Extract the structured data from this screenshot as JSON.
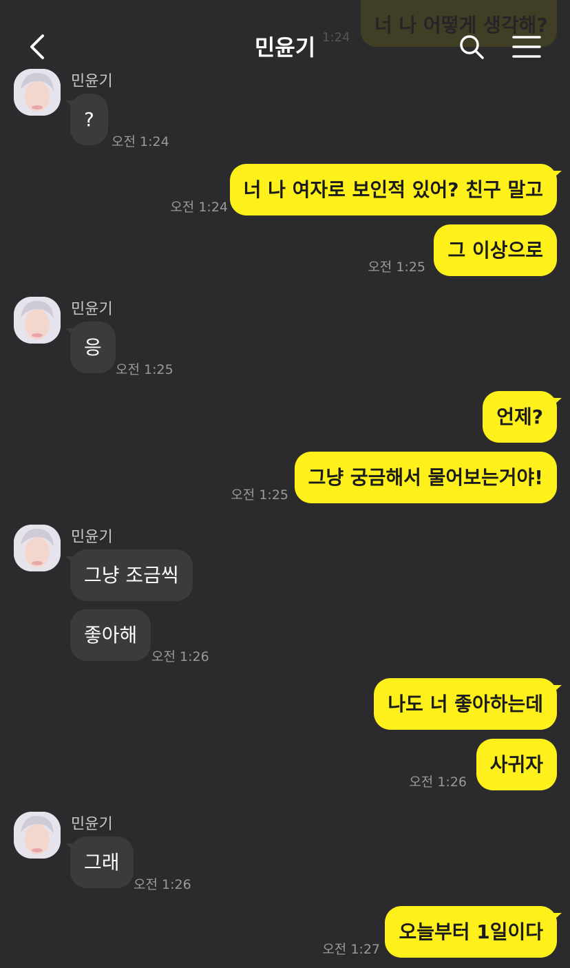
{
  "header": {
    "title": "민윤기",
    "back_icon": "chevron-left-icon",
    "search_icon": "search-icon",
    "menu_icon": "hamburger-menu-icon"
  },
  "peek": {
    "text": "너 나 어떻게 생각해?",
    "time": "1:24"
  },
  "messages": [
    {
      "sender": "민윤기",
      "text": "?",
      "time": "오전 1:24"
    },
    {
      "text": "너 나 여자로 보인적 있어? 친구 말고",
      "time": "오전 1:24"
    },
    {
      "text": "그 이상으로",
      "time": "오전 1:25"
    },
    {
      "sender": "민윤기",
      "text": "응",
      "time": "오전 1:25"
    },
    {
      "text": "언제?"
    },
    {
      "text": "그냥 궁금해서 물어보는거야!",
      "time": "오전 1:25"
    },
    {
      "sender": "민윤기",
      "text": "그냥 조금씩"
    },
    {
      "text": "좋아해",
      "time": "오전 1:26"
    },
    {
      "text": "나도 너 좋아하는데"
    },
    {
      "text": "사귀자",
      "time": "오전 1:26"
    },
    {
      "sender": "민윤기",
      "text": "그래",
      "time": "오전 1:26"
    },
    {
      "text": "오늘부터 1일이다",
      "time": "오전 1:27"
    }
  ],
  "colors": {
    "background": "#2b2b2e",
    "incoming_bubble": "#3b3b3e",
    "outgoing_bubble": "#fef01b",
    "timestamp": "#9a9a9a"
  }
}
